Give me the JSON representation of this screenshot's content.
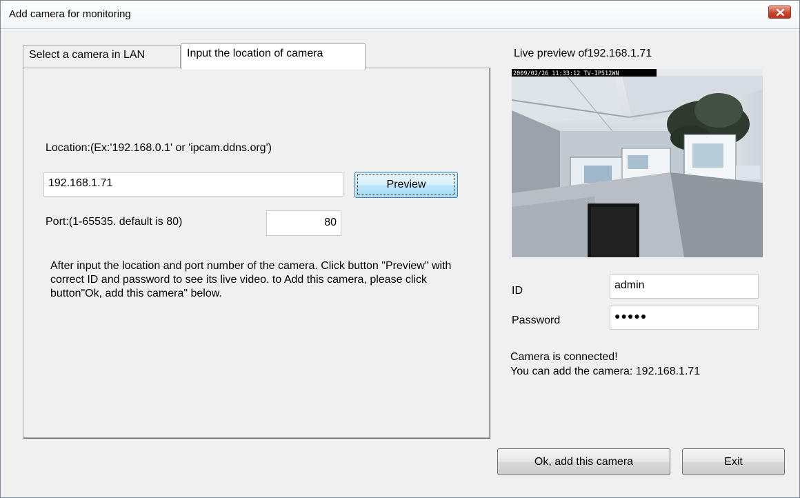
{
  "window": {
    "title": "Add camera for monitoring"
  },
  "tabs": [
    {
      "label": "Select a camera in LAN",
      "active": false
    },
    {
      "label": "Input the location of camera",
      "active": true
    }
  ],
  "location": {
    "label": "Location:(Ex:'192.168.0.1' or 'ipcam.ddns.org')",
    "value": "192.168.1.71",
    "preview_button": "Preview"
  },
  "port": {
    "label": "Port:(1-65535. default is 80)",
    "value": "80"
  },
  "help_text": "After input the location and port number of the camera. Click button \"Preview\" with correct ID and password to see its live video. to Add this camera, please click button\"Ok, add this camera\" below.",
  "live_preview": {
    "title": "Live preview of192.168.1.71",
    "overlay": "2009/02/26 11:33:12 TV-IP512WN"
  },
  "credentials": {
    "id_label": "ID",
    "id_value": "admin",
    "password_label": "Password",
    "password_mask": "●●●●●"
  },
  "status": {
    "line1": "Camera is connected!",
    "line2": "You can add the camera: 192.168.1.71"
  },
  "footer": {
    "ok_button": "Ok, add this camera",
    "exit_button": "Exit"
  },
  "icons": {
    "close": "close-icon"
  }
}
